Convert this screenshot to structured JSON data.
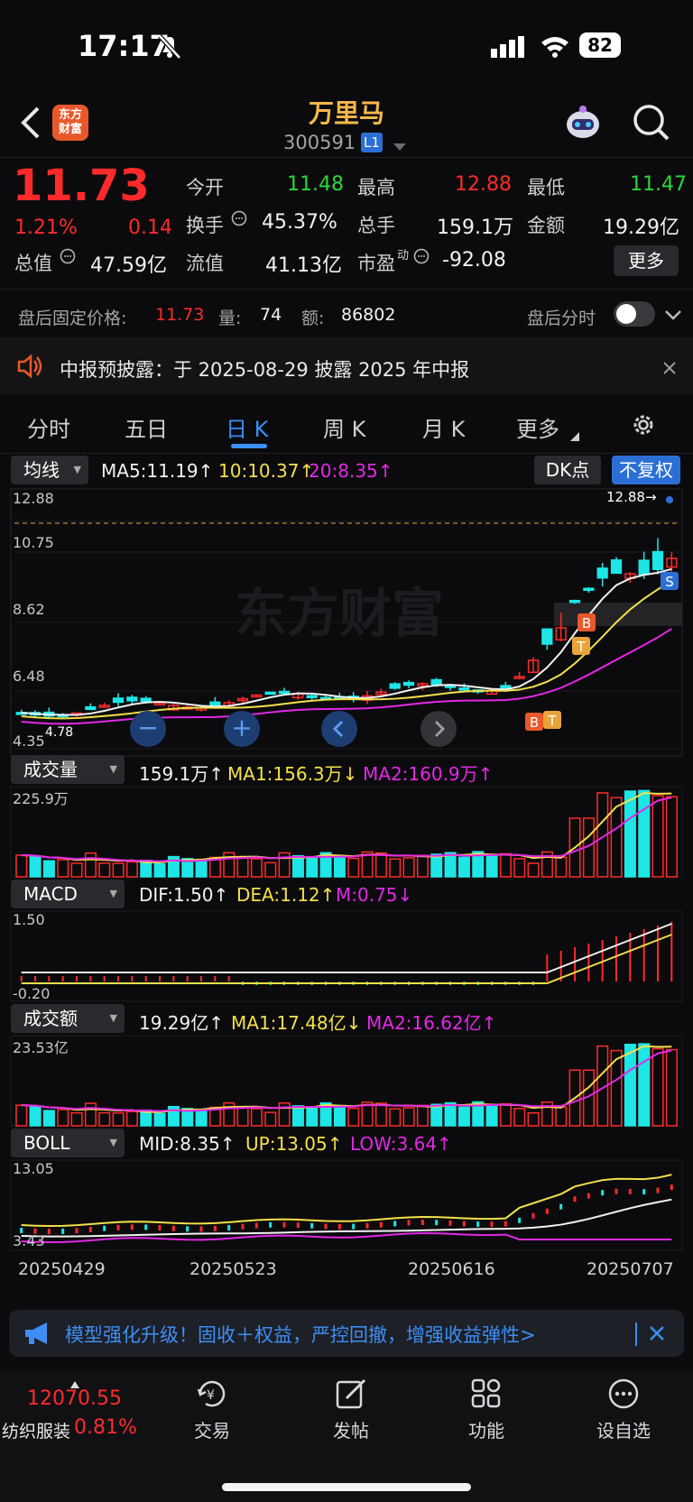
{
  "status_bar": {
    "time": "17:17",
    "battery": "82"
  },
  "header": {
    "title": "万里马",
    "code": "300591",
    "level_badge": "L1",
    "logo_text_line1": "东方",
    "logo_text_line2": "财富"
  },
  "quote": {
    "price": "11.73",
    "change_pct": "1.21%",
    "change": "0.14",
    "open_label": "今开",
    "open": "11.48",
    "high_label": "最高",
    "high": "12.88",
    "low_label": "最低",
    "low": "11.47",
    "turnover_label": "换手",
    "turnover": "45.37%",
    "volume_label": "总手",
    "volume": "159.1万",
    "amount_label": "金额",
    "amount": "19.29亿",
    "total_mv_label": "总值",
    "total_mv": "47.59亿",
    "float_mv_label": "流值",
    "float_mv": "41.13亿",
    "pe_label": "市盈",
    "pe_sup": "动",
    "pe": "-92.08",
    "more_button": "更多"
  },
  "after_hours": {
    "fixed_price_label": "盘后固定价格:",
    "fixed_price": "11.73",
    "qty_label": "量:",
    "qty": "74",
    "amt_label": "额:",
    "amt": "86802",
    "timeshare_label": "盘后分时"
  },
  "notice": {
    "text": "中报预披露：于 2025-08-29 披露 2025 年中报"
  },
  "tabs": [
    {
      "label": "分时"
    },
    {
      "label": "五日"
    },
    {
      "label": "日 K"
    },
    {
      "label": "周 K"
    },
    {
      "label": "月 K"
    },
    {
      "label": "更多"
    }
  ],
  "main_panel": {
    "selector": "均线",
    "ma5": "MA5:11.19↑",
    "ma10": "10:10.37↑",
    "ma20": "20:8.35↑",
    "dk_button": "DK点",
    "adjust_button": "不复权",
    "y_labels": [
      "12.88",
      "10.75",
      "8.62",
      "6.48",
      "4.35"
    ],
    "high_marker": "12.88→",
    "low_marker": "4.78",
    "watermark": "东方财富"
  },
  "volume_panel": {
    "selector": "成交量",
    "value": "159.1万↑",
    "ma1": "MA1:156.3万↓",
    "ma2": "MA2:160.9万↑",
    "top_label": "225.9万"
  },
  "macd_panel": {
    "selector": "MACD",
    "dif": "DIF:1.50↑",
    "dea": "DEA:1.12↑",
    "m": "M:0.75↓",
    "top_label": "1.50",
    "bottom_label": "-0.20"
  },
  "amount_panel": {
    "selector": "成交额",
    "value": "19.29亿↑",
    "ma1": "MA1:17.48亿↓",
    "ma2": "MA2:16.62亿↑",
    "top_label": "23.53亿"
  },
  "boll_panel": {
    "selector": "BOLL",
    "mid": "MID:8.35↑",
    "up": "UP:13.05↑",
    "low": "LOW:3.64↑",
    "top_label": "13.05",
    "bottom_label": "3.43"
  },
  "dates": [
    "20250429",
    "20250523",
    "20250616",
    "20250707"
  ],
  "banner": {
    "text": "模型强化升级！固收＋权益，严控回撤，增强收益弹性>"
  },
  "bottom_nav": {
    "index_value": "12070.55",
    "index_name": "纺织服装",
    "index_change": "0.81%",
    "items": [
      {
        "label": "交易"
      },
      {
        "label": "发帖"
      },
      {
        "label": "功能"
      },
      {
        "label": "设自选"
      }
    ]
  },
  "colors": {
    "up": "#ff2a2a",
    "down": "#1ee6e6",
    "ma5": "#f2f2f2",
    "ma10": "#f4e04a",
    "ma20": "#e328e6",
    "accent": "#3d8ef5"
  }
}
